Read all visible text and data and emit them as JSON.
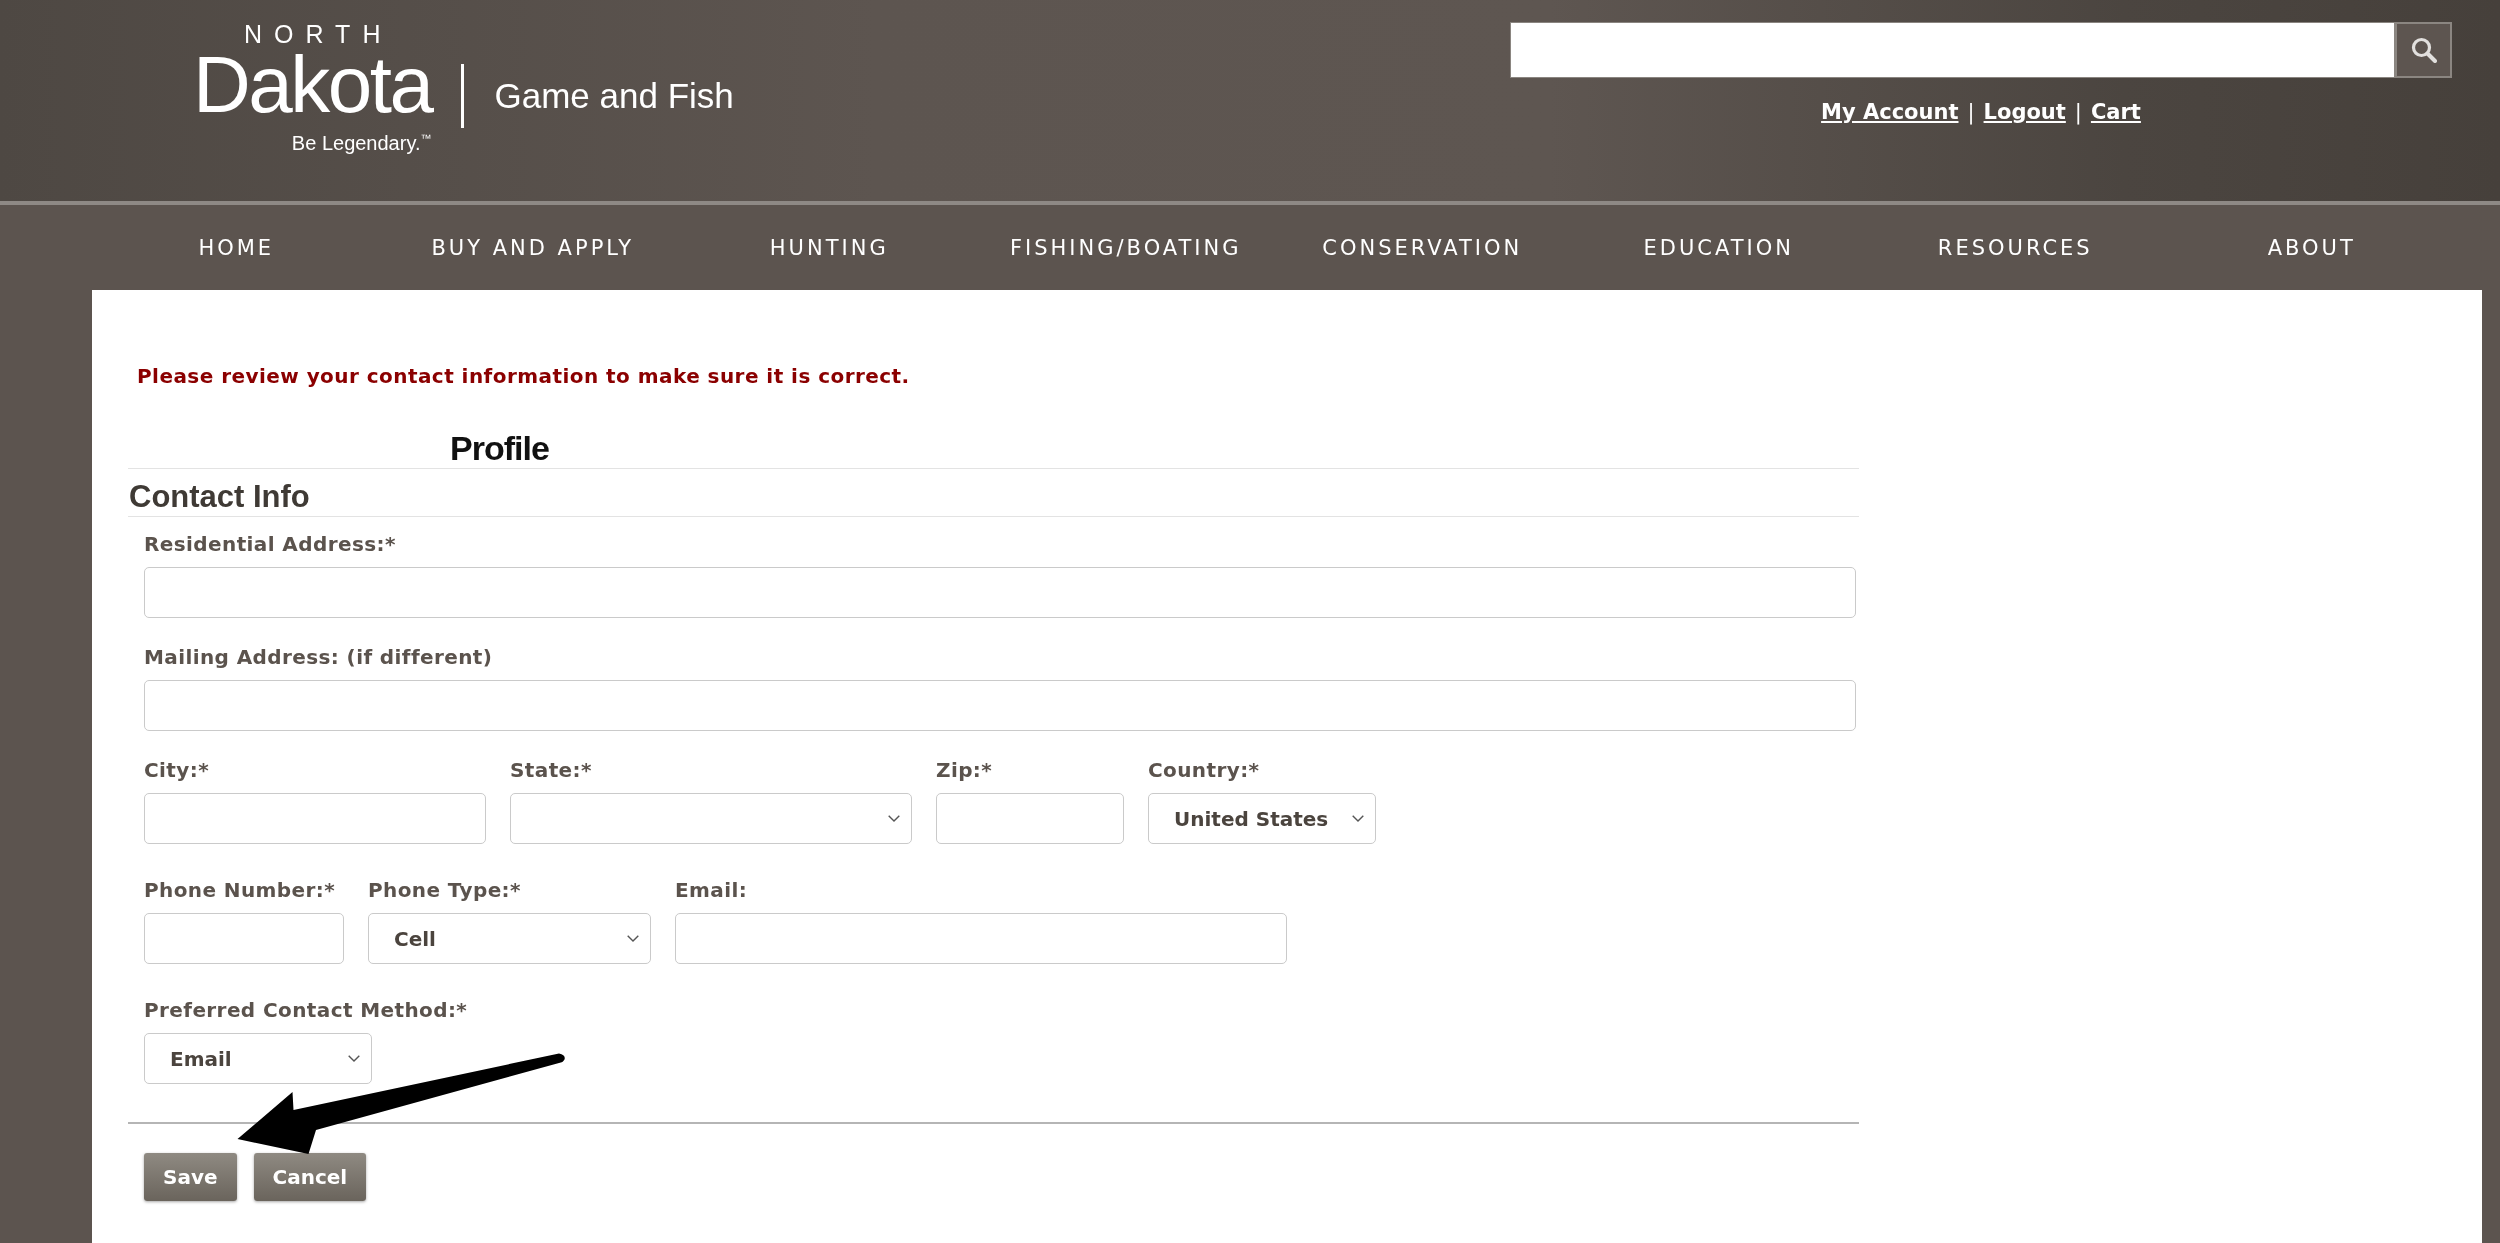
{
  "header": {
    "logo": {
      "top_text": "NORTH",
      "wordmark": "Dakota",
      "tagline": "Be Legendary.$^{™}$"
    },
    "site_title": "Game and Fish",
    "account_bar": [
      {
        "kind": "link",
        "text": "My Account"
      },
      {
        "kind": "separator",
        "text": "|"
      },
      {
        "kind": "link",
        "text": "Logout"
      },
      {
        "kind": "separator",
        "text": "|"
      },
      {
        "kind": "link",
        "text": "Cart"
      }
    ]
  },
  "nav": [
    {
      "label": "HOME"
    },
    {
      "label": "BUY AND APPLY"
    },
    {
      "label": "HUNTING"
    },
    {
      "label": "FISHING/BOATING"
    },
    {
      "label": "CONSERVATION"
    },
    {
      "label": "EDUCATION"
    },
    {
      "label": "RESOURCES"
    },
    {
      "label": "ABOUT"
    }
  ],
  "alert": "Please review your contact information to make sure it is correct.",
  "form": {
    "title": "Profile",
    "section": "Contact Info",
    "rows": [
      {
        "fields": [
          {
            "kind": "text",
            "label": "Residential Address:*"
          }
        ]
      },
      {
        "fields": [
          {
            "kind": "text",
            "label": "Mailing Address: (if different)"
          }
        ]
      },
      {
        "fields": [
          {
            "kind": "text",
            "label": "City:*"
          },
          {
            "kind": "select",
            "label": "State:*"
          },
          {
            "kind": "text",
            "label": "Zip:*"
          },
          {
            "kind": "select",
            "label": "Country:*",
            "value": "United States"
          }
        ]
      },
      {
        "fields": [
          {
            "kind": "text",
            "label": "Phone Number:*"
          },
          {
            "kind": "select",
            "label": "Phone Type:*",
            "value": "Cell"
          },
          {
            "kind": "text",
            "label": "Email:"
          }
        ]
      },
      {
        "fields": [
          {
            "kind": "select",
            "label": "Preferred Contact Method:*",
            "value": "Email"
          }
        ]
      }
    ],
    "buttons": [
      {
        "label": "Save"
      },
      {
        "label": "Cancel"
      }
    ]
  },
  "annotation": {
    "kind": "arrow"
  }
}
